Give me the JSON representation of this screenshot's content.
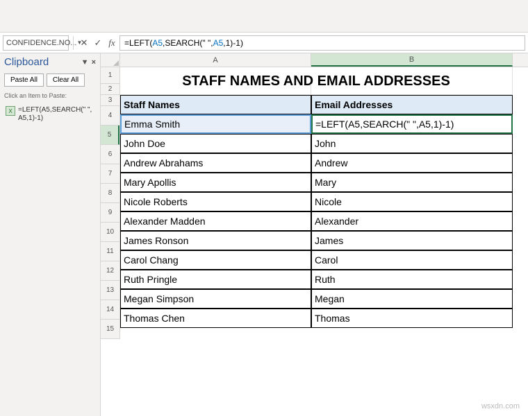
{
  "formula_bar": {
    "name_box": "CONFIDENCE.NO...",
    "cancel_icon": "✕",
    "enter_icon": "✓",
    "fx_label": "fx",
    "formula_prefix": "=LEFT(",
    "formula_ref1": "A5",
    "formula_mid": ",SEARCH(\" \",",
    "formula_ref2": "A5",
    "formula_suf1": ",",
    "formula_num": "1",
    "formula_suf2": ")-1)"
  },
  "clipboard": {
    "title": "Clipboard",
    "paste_all": "Paste All",
    "clear_all": "Clear All",
    "hint": "Click an Item to Paste:",
    "item1_icon": "X",
    "item1_text": "=LEFT(A5,SEARCH(\" \",A5,1)-1)"
  },
  "columns": {
    "A": "A",
    "B": "B"
  },
  "row_nums": [
    "1",
    "2",
    "3",
    "4",
    "5",
    "6",
    "7",
    "8",
    "9",
    "10",
    "11",
    "12",
    "13",
    "14",
    "15"
  ],
  "title": "STAFF NAMES AND EMAIL ADDRESSES",
  "headers": {
    "a": "Staff Names",
    "b": "Email Addresses"
  },
  "rows": [
    {
      "a": "Emma Smith",
      "b_formula": true
    },
    {
      "a": "John Doe",
      "b": "John"
    },
    {
      "a": "Andrew Abrahams",
      "b": "Andrew"
    },
    {
      "a": "Mary Apollis",
      "b": "Mary"
    },
    {
      "a": "Nicole Roberts",
      "b": "Nicole"
    },
    {
      "a": "Alexander Madden",
      "b": "Alexander"
    },
    {
      "a": "James Ronson",
      "b": "James"
    },
    {
      "a": "Carol Chang",
      "b": "Carol"
    },
    {
      "a": "Ruth Pringle",
      "b": "Ruth"
    },
    {
      "a": "Megan Simpson",
      "b": "Megan"
    },
    {
      "a": "Thomas Chen",
      "b": "Thomas"
    }
  ],
  "cell_formula": {
    "prefix": "=LEFT(A5,SEARCH",
    "paren": "(",
    "q": "\" \"",
    "mid": ",A5,1)-1)"
  },
  "watermark": "wsxdn.com"
}
